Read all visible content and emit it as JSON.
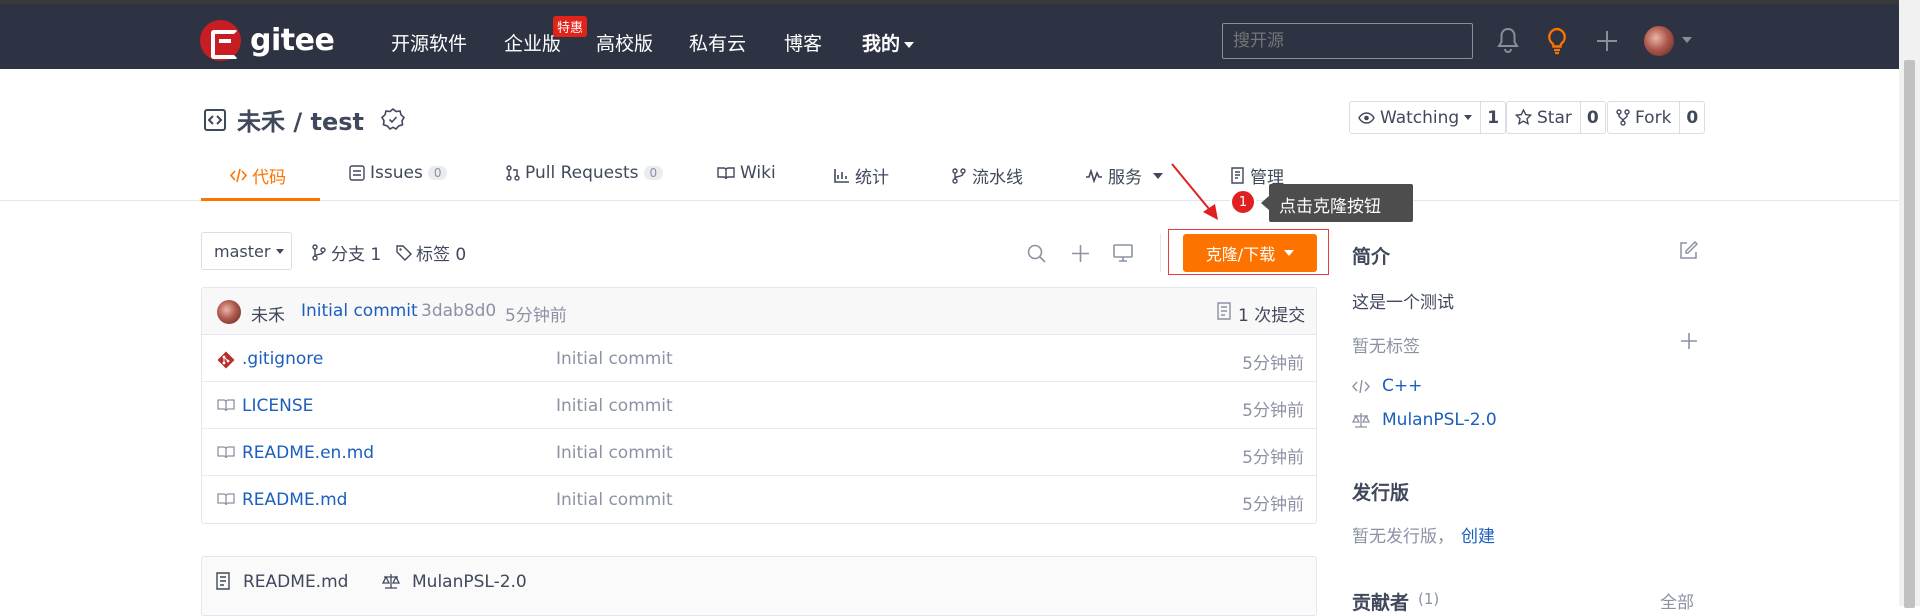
{
  "header": {
    "logo_text": "gitee",
    "nav": [
      "开源软件",
      "企业版",
      "高校版",
      "私有云",
      "博客",
      "我的"
    ],
    "hot_badge": "特惠",
    "search_placeholder": "搜开源"
  },
  "repo": {
    "owner": "未禾",
    "separator": "/",
    "name": "test",
    "watch": {
      "label": "Watching",
      "count": "1"
    },
    "star": {
      "label": "Star",
      "count": "0"
    },
    "fork": {
      "label": "Fork",
      "count": "0"
    }
  },
  "tabs": [
    {
      "label": "代码",
      "icon": "code-icon"
    },
    {
      "label": "Issues",
      "badge": "0",
      "icon": "issues-icon"
    },
    {
      "label": "Pull Requests",
      "badge": "0",
      "icon": "pull-request-icon"
    },
    {
      "label": "Wiki",
      "icon": "book-icon"
    },
    {
      "label": "统计",
      "icon": "chart-icon"
    },
    {
      "label": "流水线",
      "icon": "pipeline-icon"
    },
    {
      "label": "服务",
      "icon": "pulse-icon"
    },
    {
      "label": "管理",
      "icon": "settings-doc-icon"
    }
  ],
  "toolbar": {
    "branch": "master",
    "branches": "分支 1",
    "tags": "标签 0",
    "clone_label": "克隆/下载"
  },
  "tooltip": {
    "number": "1",
    "text": "点击克隆按钮"
  },
  "commit": {
    "author": "未禾",
    "message": "Initial commit",
    "hash": "3dab8d0",
    "time": "5分钟前",
    "count": "1 次提交"
  },
  "files": [
    {
      "name": ".gitignore",
      "message": "Initial commit",
      "time": "5分钟前",
      "icon": "git-icon"
    },
    {
      "name": "LICENSE",
      "message": "Initial commit",
      "time": "5分钟前",
      "icon": "file-icon"
    },
    {
      "name": "README.en.md",
      "message": "Initial commit",
      "time": "5分钟前",
      "icon": "file-icon"
    },
    {
      "name": "README.md",
      "message": "Initial commit",
      "time": "5分钟前",
      "icon": "file-icon"
    }
  ],
  "readme_bar": {
    "file": "README.md",
    "license": "MulanPSL-2.0"
  },
  "sidebar": {
    "intro_title": "简介",
    "description": "这是一个测试",
    "no_tags": "暂无标签",
    "language": "C++",
    "license": "MulanPSL-2.0",
    "releases_title": "发行版",
    "no_releases": "暂无发行版，",
    "create_link": "创建",
    "contributors_title": "贡献者",
    "contributors_count": "(1)",
    "all_link": "全部"
  },
  "colors": {
    "accent": "#fe7300",
    "header_bg": "#2e3344",
    "link": "#1b5ebd"
  }
}
